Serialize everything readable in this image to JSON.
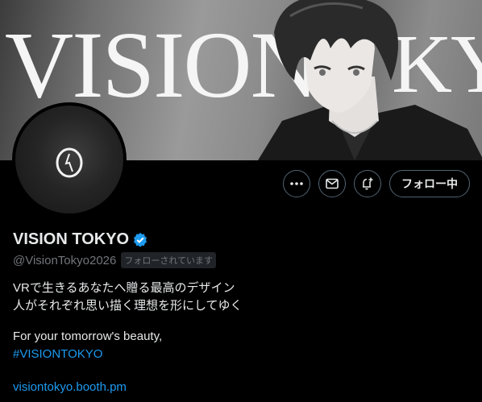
{
  "banner": {
    "wordmark": "VISION",
    "wordmark_tail": "KYO"
  },
  "profile": {
    "name": "VISION TOKYO",
    "handle": "@VisionTokyo2026",
    "follows_you": "フォローされています"
  },
  "actions": {
    "follow_label": "フォロー中"
  },
  "bio": {
    "line1": "VRで生きるあなたへ贈る最高のデザイン",
    "line2": "人がそれぞれ思い描く理想を形にしてゆく",
    "line3": "For your tomorrow's beauty,",
    "hashtag": "#VISIONTOKYO"
  },
  "website": "visiontokyo.booth.pm",
  "colors": {
    "accent": "#1d9bf0",
    "background": "#000000",
    "muted": "#71767b"
  },
  "icons": [
    "more-icon",
    "message-icon",
    "notification-plus-icon",
    "verified-badge-icon"
  ]
}
